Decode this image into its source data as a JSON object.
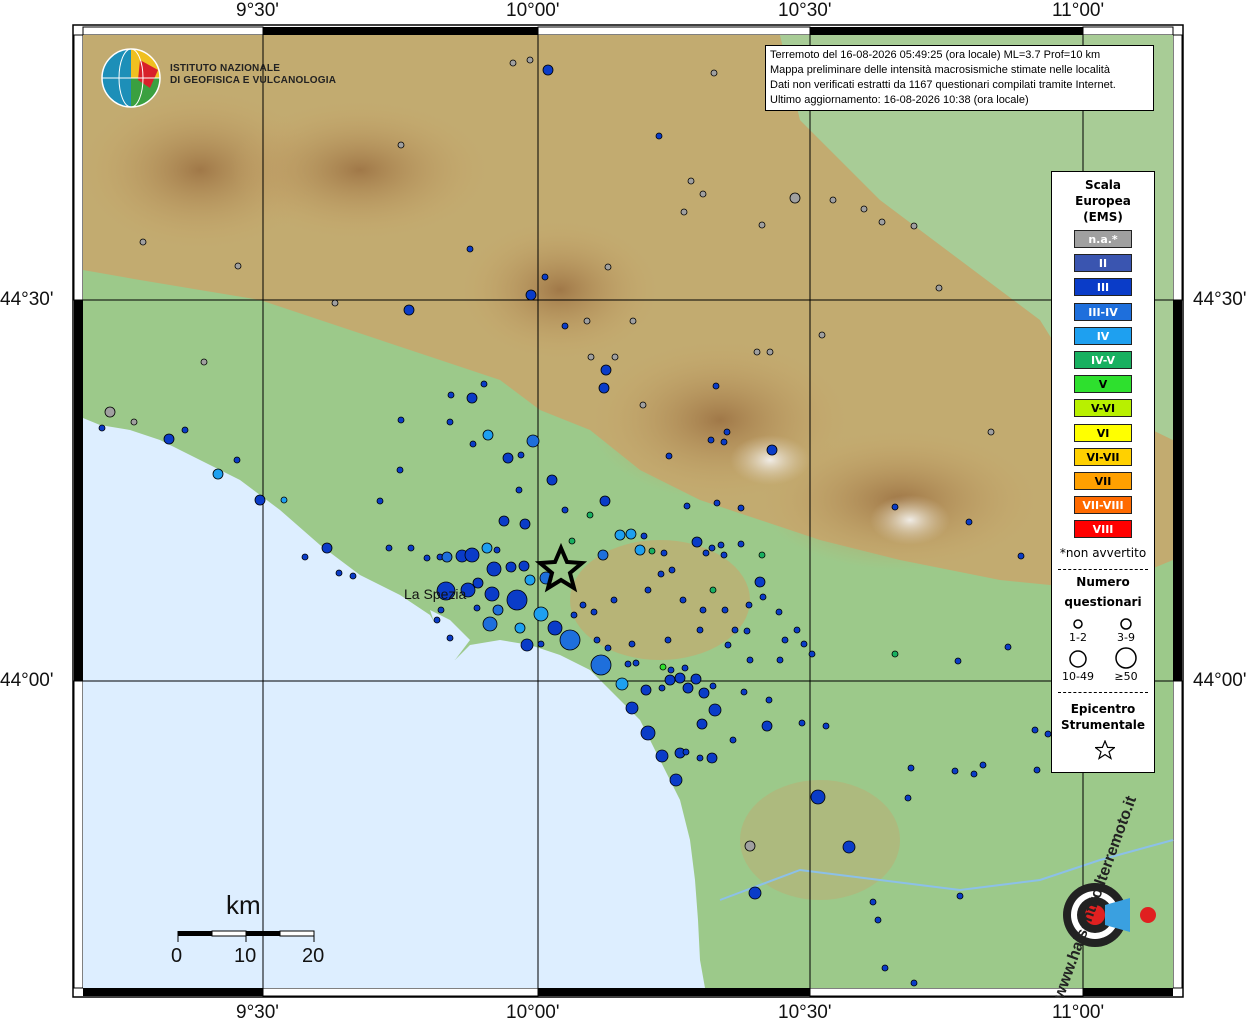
{
  "map": {
    "lon_ticks_top": [
      "9°30'",
      "10°00'",
      "10°30'",
      "11°00'"
    ],
    "lon_ticks_bottom": [
      "9°30'",
      "10°00'",
      "10°30'",
      "11°00'"
    ],
    "lat_ticks_left": [
      "44°30'",
      "44°00'"
    ],
    "lat_ticks_right": [
      "44°30'",
      "44°00'"
    ],
    "city_label": "La Spezia",
    "colors": {
      "sea": "#ddeeff",
      "lowland": "#9cc98a",
      "hills": "#c9a66b",
      "mountains": "#a07848",
      "snow": "#e8e0d4"
    }
  },
  "logo": {
    "line1": "ISTITUTO NAZIONALE",
    "line2": "DI GEOFISICA E VULCANOLOGIA",
    "icon": "ingv-globe-icon"
  },
  "info": {
    "line1": "Terremoto del 16-08-2026 05:49:25 (ora locale) ML=3.7 Prof=10 km",
    "line2": "Mappa preliminare delle intensità macrosismiche stimate nelle località",
    "line3": "Dati non verificati estratti da 1167 questionari compilati tramite Internet.",
    "line4": "Ultimo aggiornamento: 16-08-2026 10:38 (ora locale)"
  },
  "legend": {
    "title1": "Scala",
    "title2": "Europea",
    "title3": "(EMS)",
    "classes": [
      {
        "label": "n.a.*",
        "color": "#a0a0a0"
      },
      {
        "label": "II",
        "color": "#3a55b0"
      },
      {
        "label": "III",
        "color": "#0a3cc8"
      },
      {
        "label": "III-IV",
        "color": "#1e6fdc"
      },
      {
        "label": "IV",
        "color": "#1ea0f0"
      },
      {
        "label": "IV-V",
        "color": "#18b060"
      },
      {
        "label": "V",
        "color": "#2ee02e"
      },
      {
        "label": "V-VI",
        "color": "#b8f000"
      },
      {
        "label": "VI",
        "color": "#ffff00"
      },
      {
        "label": "VI-VII",
        "color": "#ffd000"
      },
      {
        "label": "VII",
        "color": "#ffa000"
      },
      {
        "label": "VII-VIII",
        "color": "#ff6a00"
      },
      {
        "label": "VIII",
        "color": "#ff0000"
      }
    ],
    "non_avvertito": "*non avvertito",
    "numero_title1": "Numero",
    "numero_title2": "questionari",
    "sizes": [
      "1-2",
      "3-9",
      "10-49",
      "≥50"
    ],
    "epicentro1": "Epicentro",
    "epicentro2": "Strumentale"
  },
  "scalebar": {
    "unit": "km",
    "labels": [
      "0",
      "10",
      "20"
    ]
  },
  "watermark": {
    "text": "www.haisentitoilterremoto.it",
    "icon": "hsit-target-icon"
  },
  "epicenter_icon": "epicenter-star-icon"
}
